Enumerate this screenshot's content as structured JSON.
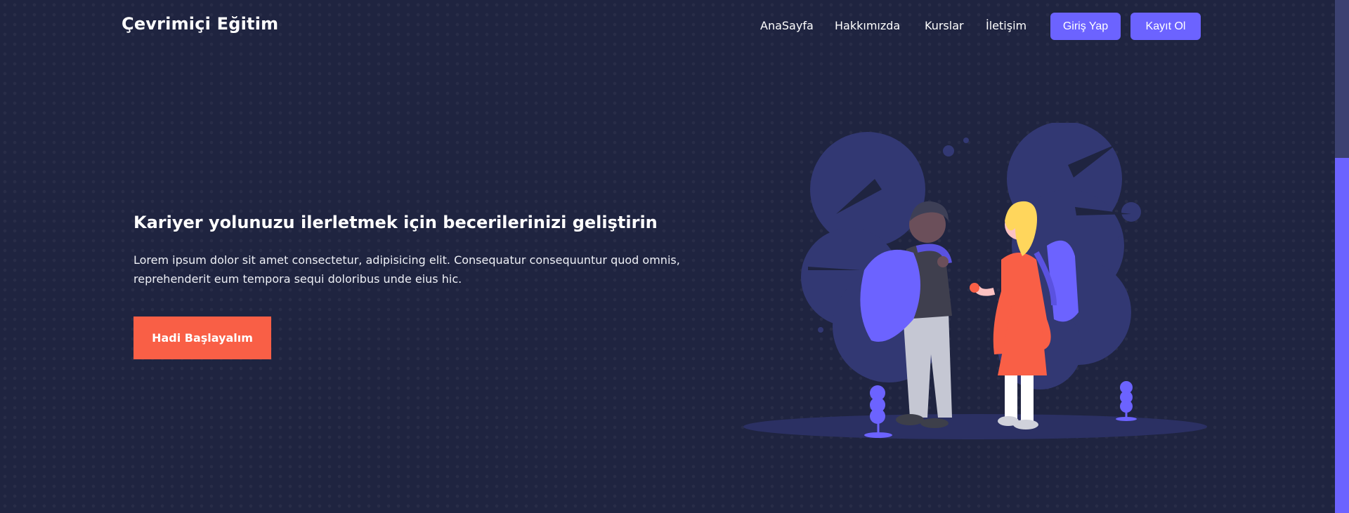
{
  "header": {
    "brand": "Çevrimiçi Eğitim",
    "nav": [
      "AnaSayfa",
      "Hakkımızda",
      "Kurslar",
      "İletişim"
    ],
    "login_label": "Giriş Yap",
    "register_label": "Kayıt Ol"
  },
  "hero": {
    "title": "Kariyer yolunuzu ilerletmek için becerilerinizi geliştirin",
    "text": "Lorem ipsum dolor sit amet consectetur, adipisicing elit. Consequatur consequuntur quod omnis, reprehenderit eum tempora sequi doloribus unde eius hic.",
    "cta_label": "Hadi Başlayalım"
  },
  "colors": {
    "background": "#1f2440",
    "accent": "#6c63ff",
    "cta": "#f95f46"
  },
  "icons": {
    "illustration": "students-with-backpacks-illustration"
  }
}
